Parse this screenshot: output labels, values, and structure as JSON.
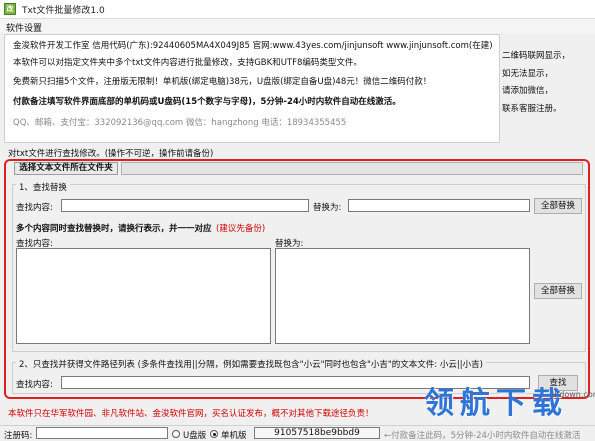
{
  "window": {
    "title": "Txt文件批量修改1.0",
    "icon_letter": "改"
  },
  "menu": {
    "settings": "软件设置"
  },
  "info": {
    "line1": "金浚软件开发工作室  信用代码(广东):92440605MA4X049J85  官网:www.43yes.com/jinjunsoft  www.jinjunsoft.com(在建)",
    "line2": "本软件可以对指定文件夹中多个txt文件内容进行批量修改，支持GBK和UTF8编码类型文件。",
    "line3": "免费新只扫描5个文件，注册版无限制！单机版(绑定电脑)38元，U盘版(绑定自备U盘)48元！微信二维码付款！",
    "line4": "付款备注填写软件界面底部的单机码或U盘码(15个数字与字母)，5分钟-24小时内软件自动在线激活。",
    "line5": "QQ、邮箱、支付宝：332092136@qq.com     微信：hangzhong     电话：18934355455"
  },
  "side": {
    "line1": "二维码联网显示，",
    "line2": "如无法显示，",
    "line3": "请添加微信，",
    "line4": "联系客服注册。"
  },
  "op_note": "对txt文件进行查找修改。(操作不可逆，操作前请备份)",
  "folder_button": "选择文本文件所在文件夹",
  "section1": {
    "title": "1、查找替换",
    "find_label": "查找内容:",
    "replace_label": "替换为:",
    "replace_all": "全部替换",
    "multi_note": "多个内容同时查找替换时，请换行表示，并一一对应",
    "multi_note_red": "(建议先备份)",
    "multi_find_label": "查找内容:",
    "multi_replace_label": "替换为:",
    "multi_replace_all": "全部替换"
  },
  "section2": {
    "title": "2、只查找并获得文件路径列表 (多条件查找用||分隔，例如需要查找既包含\"小云\"同时也包含\"小吉\"的文本文件: 小云||小吉)",
    "find_label": "查找内容:",
    "find_button": "查找"
  },
  "notice": "本软件只在华军软件园、非凡软件站、金浚软件官网，买名认证发布，概不对其他下载途径负责！",
  "status": {
    "reg_label": "注册码:",
    "usb_label": "U盘版",
    "single_label": "单机版",
    "machine_code": "91057518be9bbd9",
    "hint": "←付款备注此码，5分钟-24小时内软件自动在线激活"
  },
  "watermark": {
    "text": "领航下载",
    "url": "lhdown.com"
  },
  "colors": {
    "accent_red": "#e02020",
    "notice_red": "#d00000",
    "watermark_blue": "#2f75d6"
  }
}
